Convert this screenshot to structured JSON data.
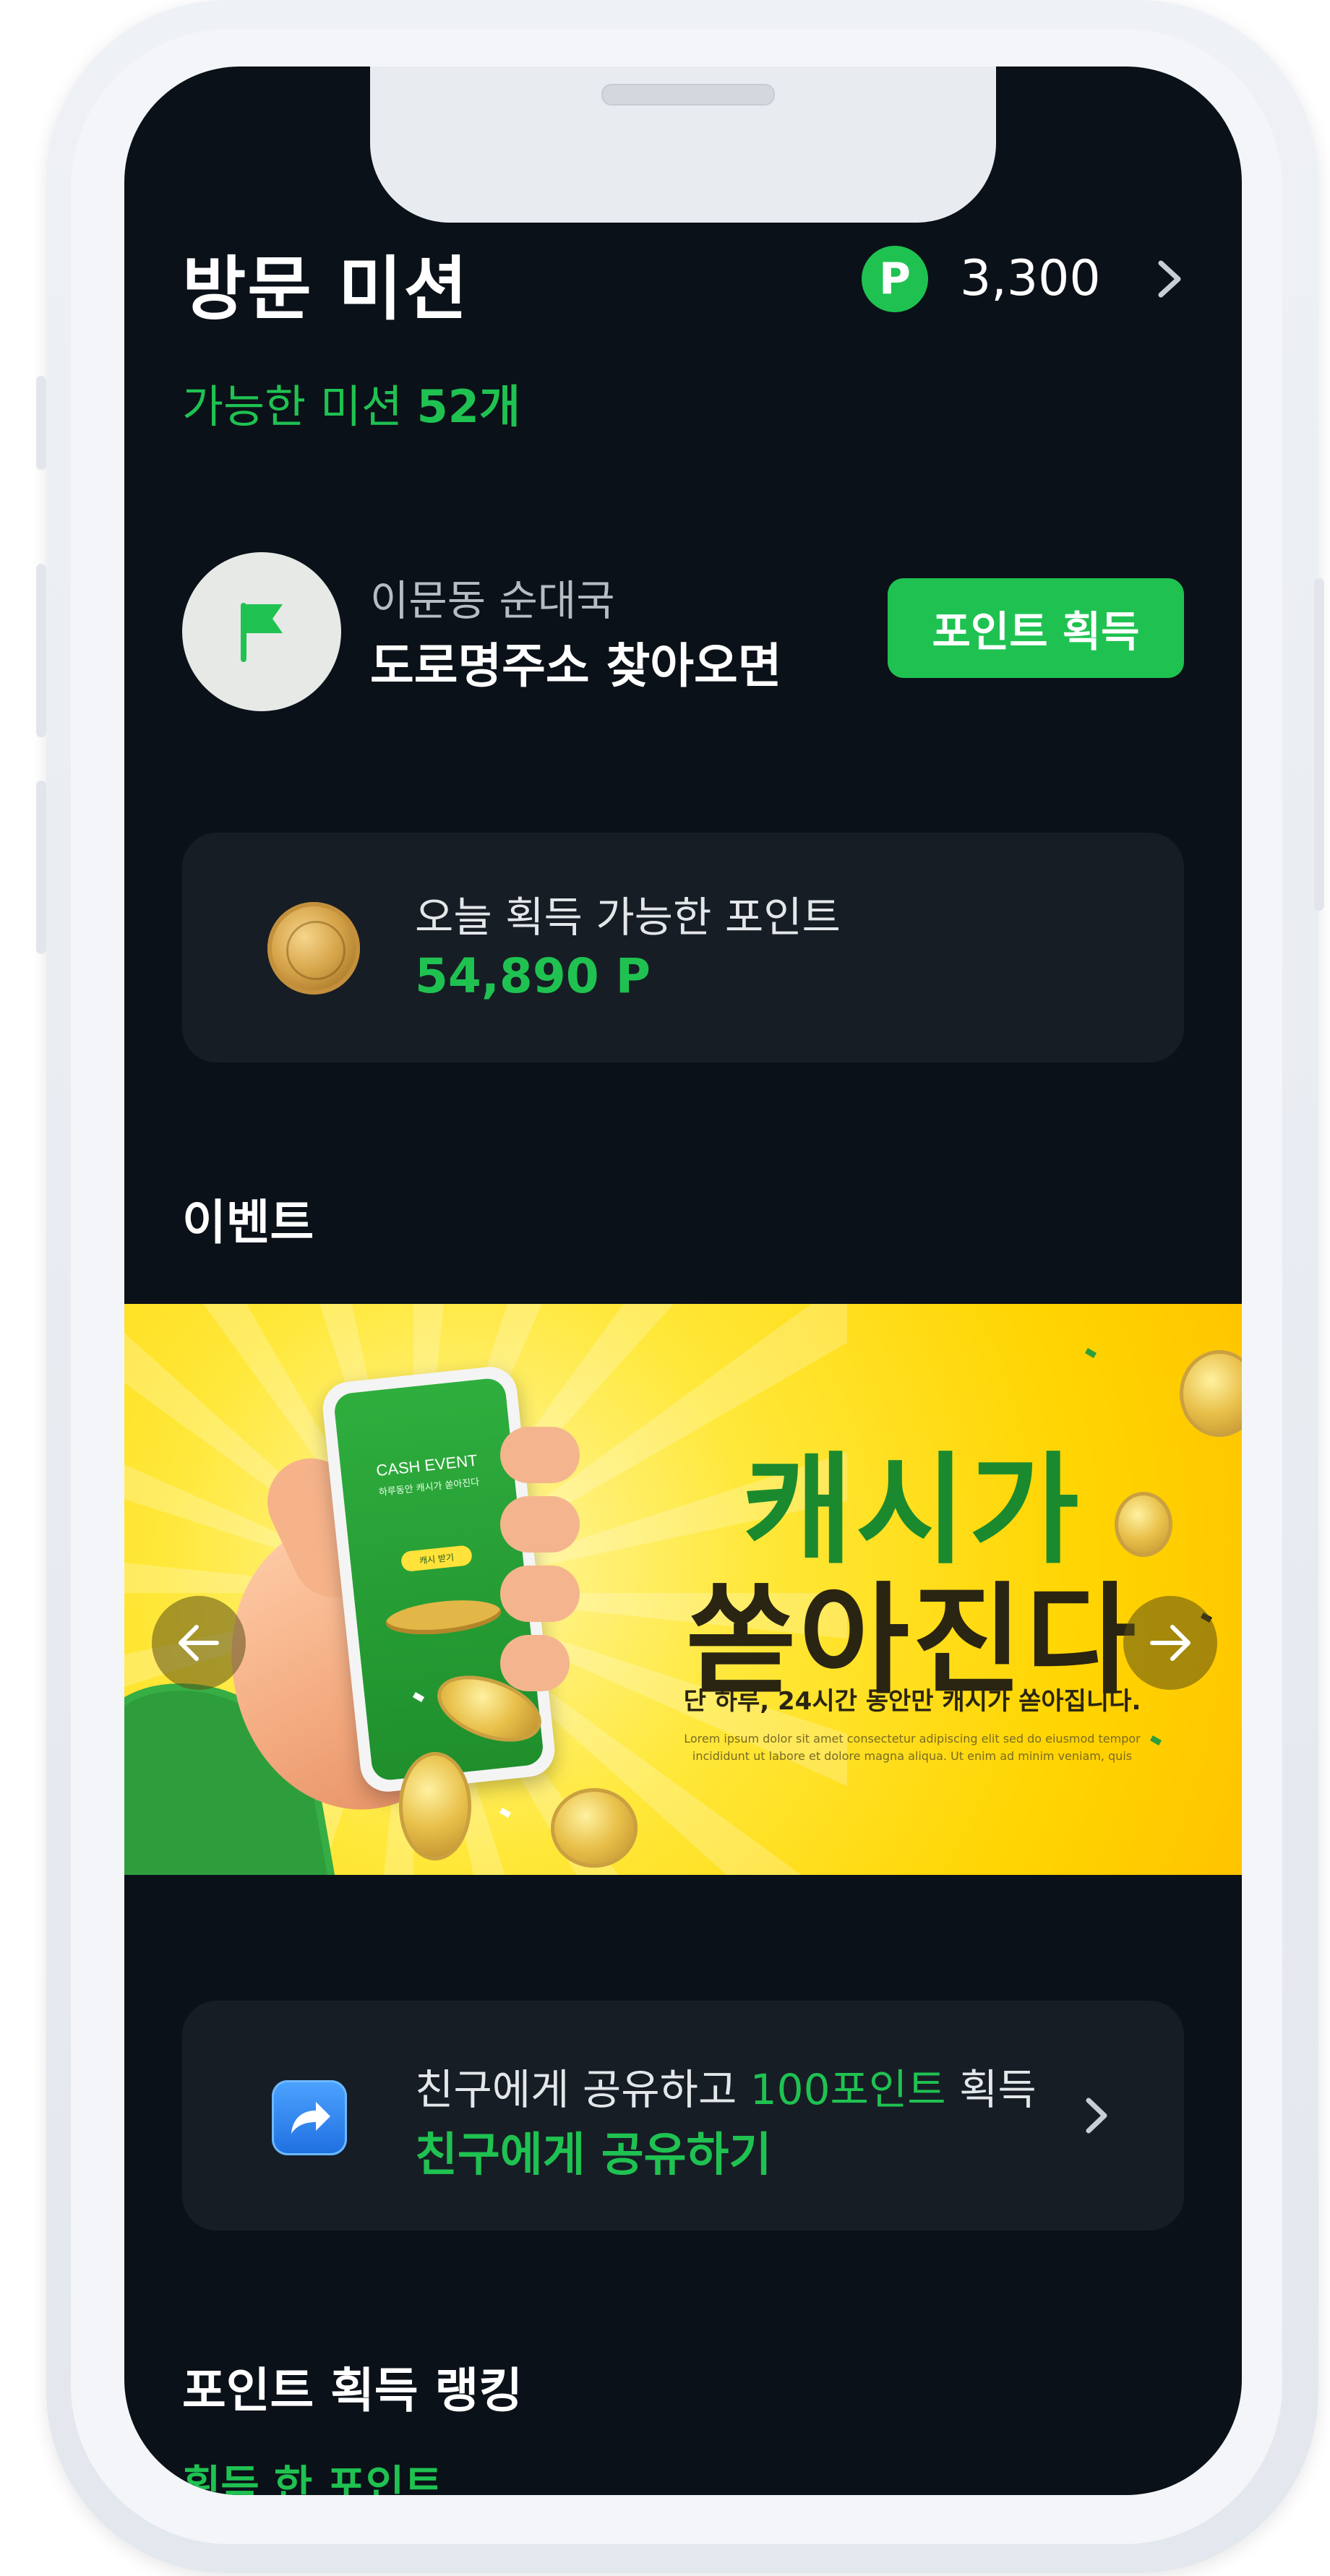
{
  "header": {
    "title": "방문 미션",
    "point_badge": "P",
    "point_balance": "3,300"
  },
  "missions": {
    "available_prefix": "가능한 미션",
    "available_count": "52개"
  },
  "mission_item": {
    "location": "이문동 순대국",
    "title": "도로명주소 찾아오면",
    "button_label": "포인트 획득"
  },
  "today_points": {
    "label": "오늘 획득 가능한 포인트",
    "value": "54,890 P"
  },
  "event_section": {
    "title": "이벤트",
    "banner": {
      "phone_title": "CASH EVENT",
      "phone_subtitle": "하루동안 캐시가 쏟아진다",
      "phone_button": "캐시 받기",
      "headline_line1": "캐시가",
      "headline_line2": "쏟아진다",
      "subtitle": "단 하루, 24시간 동안만 캐시가 쏟아집니다.",
      "lorem_line1": "Lorem ipsum dolor sit amet consectetur adipiscing elit sed do eiusmod tempor",
      "lorem_line2": "incididunt ut labore et dolore magna aliqua. Ut enim ad minim veniam, quis"
    }
  },
  "share": {
    "label_prefix": "친구에게 공유하고 ",
    "label_highlight": "100포인트",
    "label_suffix": " 획득",
    "action": "친구에게 공유하기"
  },
  "ranking": {
    "title": "포인트 획득 랭킹",
    "subtitle": "획득 한 포인트"
  },
  "colors": {
    "accent": "#1fc251",
    "background": "#0b1118",
    "card": "#171d25"
  }
}
